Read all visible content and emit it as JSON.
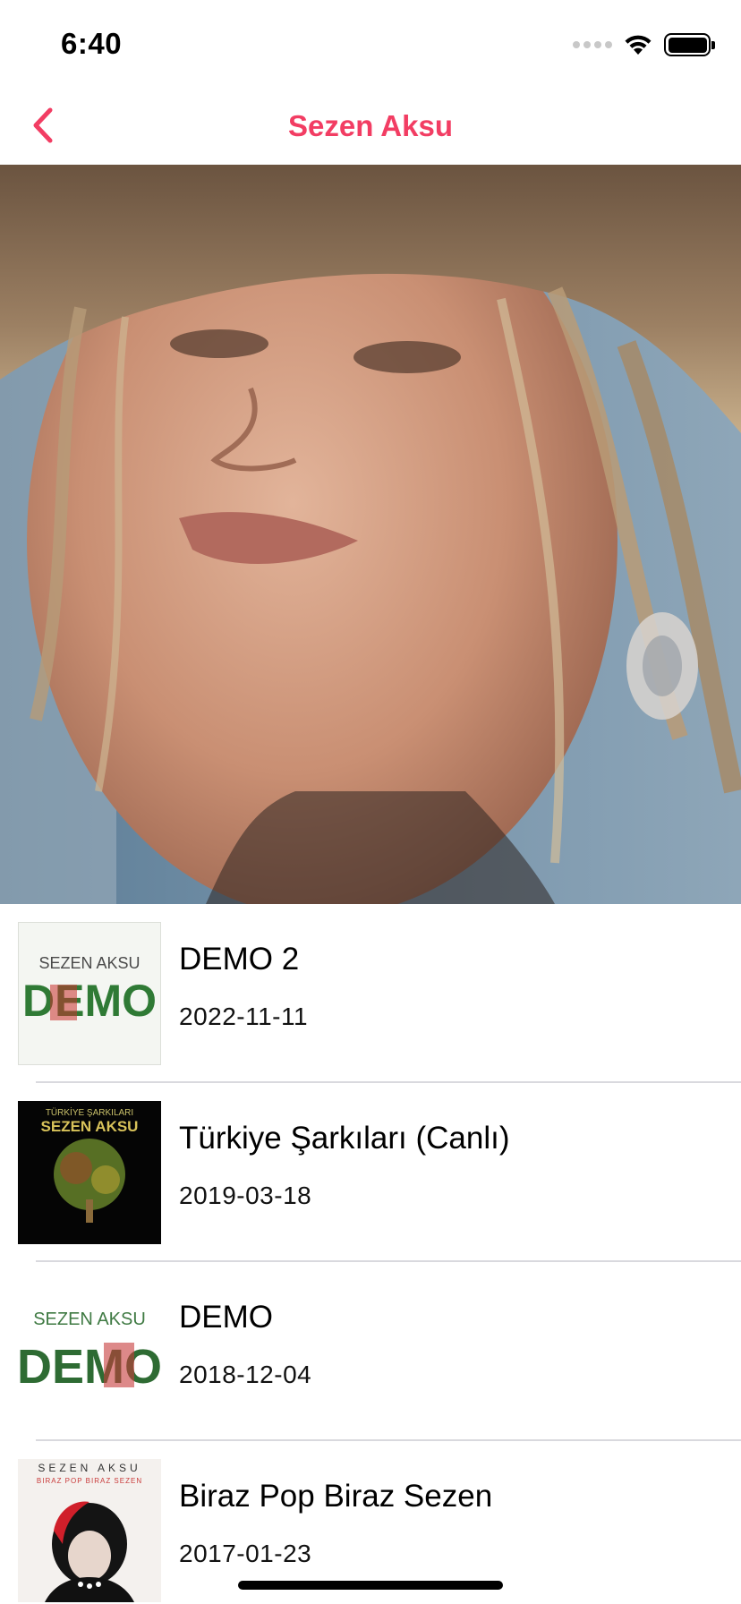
{
  "status_bar": {
    "time": "6:40",
    "icons": [
      "signal-icon",
      "wifi-icon",
      "battery-icon"
    ]
  },
  "nav": {
    "back_icon": "chevron-left-icon",
    "title": "Sezen Aksu",
    "accent_color": "#f23d63"
  },
  "hero": {
    "image": "artist-photo"
  },
  "albums": [
    {
      "title": "DEMO 2",
      "date": "2022-11-11",
      "cover_text": [
        "SEZEN AKSU",
        "DEMO"
      ]
    },
    {
      "title": "Türkiye Şarkıları (Canlı)",
      "date": "2019-03-18",
      "cover_text": [
        "TÜRKİYE ŞARKILARI",
        "SEZEN AKSU"
      ]
    },
    {
      "title": "DEMO",
      "date": "2018-12-04",
      "cover_text": [
        "SEZEN AKSU",
        "DEMO"
      ]
    },
    {
      "title": "Biraz Pop Biraz Sezen",
      "date": "2017-01-23",
      "cover_text": [
        "SEZEN AKSU",
        "BIRAZ POP BIRAZ SEZEN"
      ]
    }
  ]
}
